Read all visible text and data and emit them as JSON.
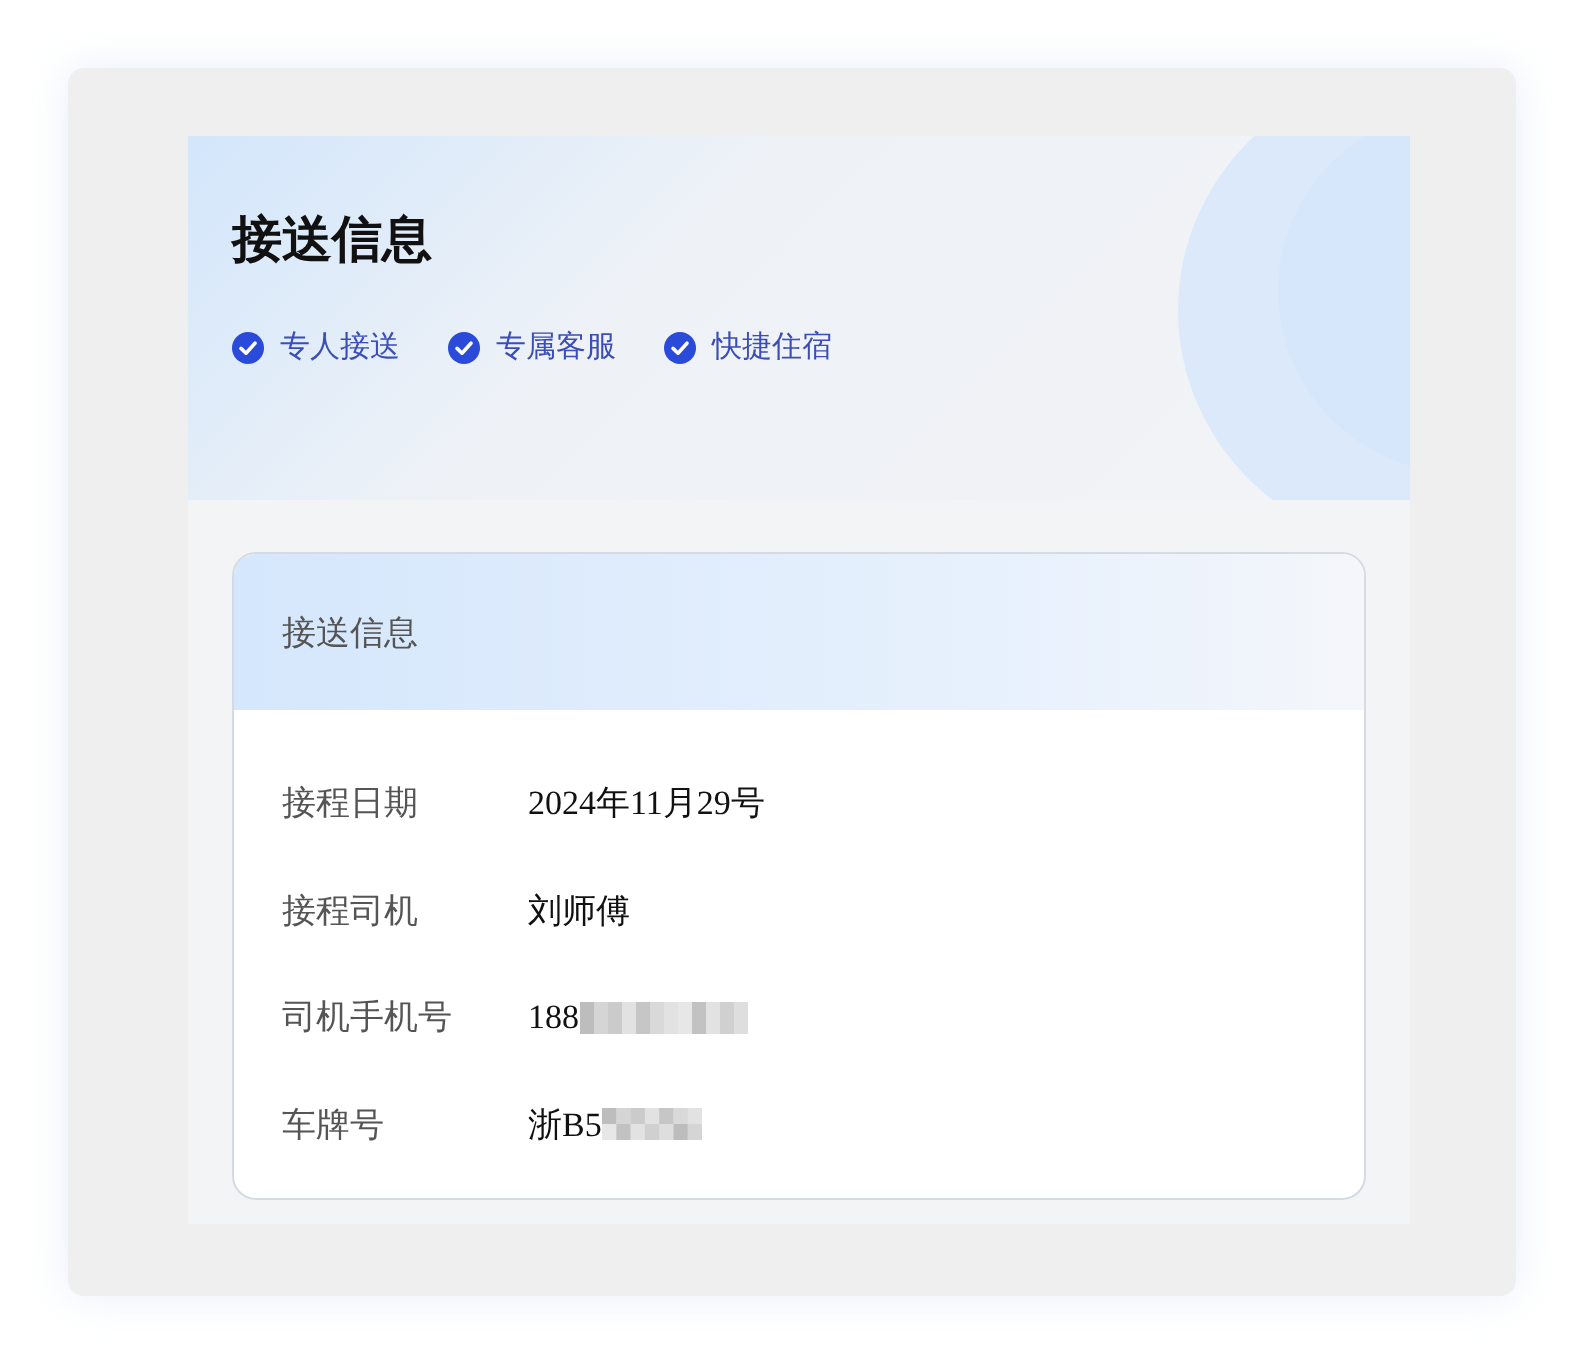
{
  "header": {
    "title": "接送信息",
    "features": [
      {
        "label": "专人接送",
        "checked": true
      },
      {
        "label": "专属客服",
        "checked": true
      },
      {
        "label": "快捷住宿",
        "checked": true
      }
    ]
  },
  "card": {
    "title": "接送信息",
    "rows": [
      {
        "label": "接程日期",
        "value": "2024年11月29号",
        "redacted": false
      },
      {
        "label": "接程司机",
        "value": "刘师傅",
        "redacted": false
      },
      {
        "label": "司机手机号",
        "value": "188",
        "redacted": true
      },
      {
        "label": "车牌号",
        "value": "浙B5",
        "redacted": true
      }
    ]
  }
}
